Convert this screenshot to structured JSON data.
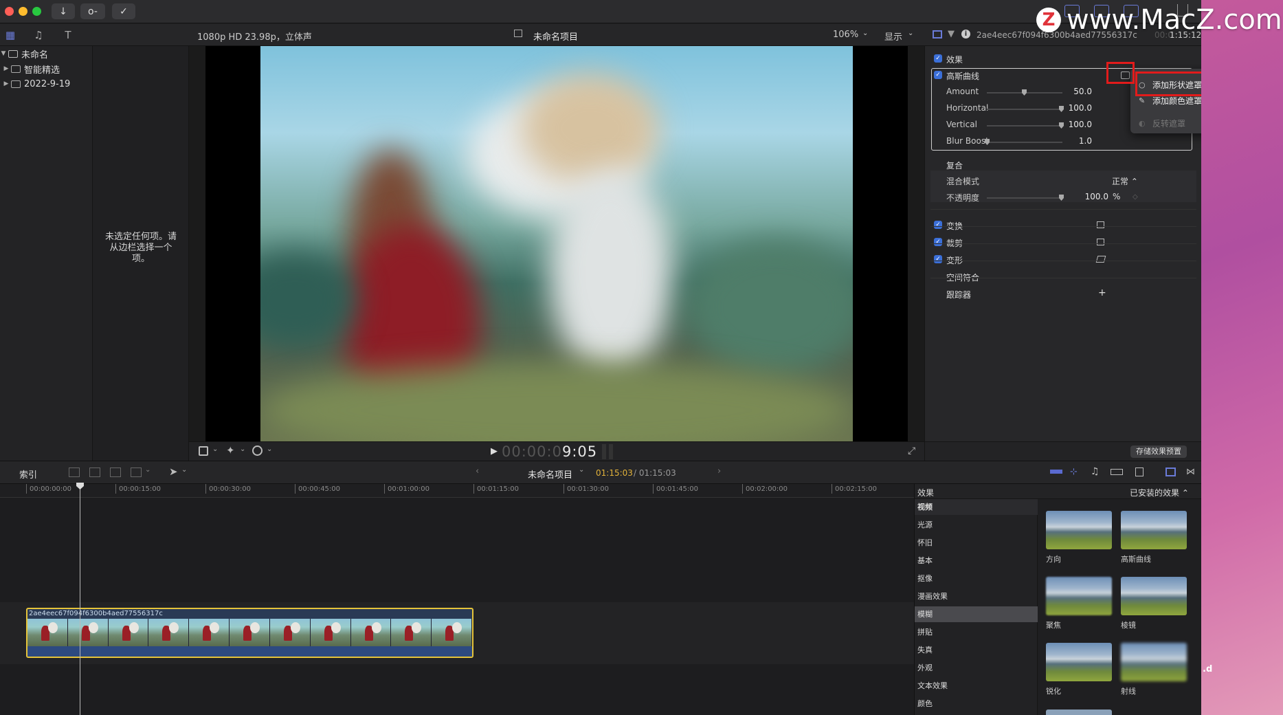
{
  "titlebar": {
    "lights": [
      "#ff5f57",
      "#febc2e",
      "#28c840"
    ],
    "buttons": [
      "↓",
      "o-",
      "✓"
    ]
  },
  "watermark": {
    "logo": "Z",
    "text": "www.MacZ.com"
  },
  "sidebar": {
    "items": [
      {
        "label": "未命名",
        "expanded": true
      },
      {
        "label": "智能精选"
      },
      {
        "label": "2022-9-19"
      }
    ]
  },
  "browser": {
    "empty_message": "未选定任何项。请从边栏选择一个项。"
  },
  "viewer": {
    "format": "1080p HD 23.98p，立体声",
    "project": "未命名项目",
    "zoom": "106%",
    "display_menu": "显示",
    "timecode_dim": "00:00:0",
    "timecode_bright": "9:05"
  },
  "inspector": {
    "clip_name": "2ae4eec67f094f6300b4aed77556317c",
    "duration": "1:15:12",
    "duration_prefix": "00:0",
    "effects_label": "效果",
    "effect_name": "高斯曲线",
    "params": [
      {
        "name": "Amount",
        "value": "50.0",
        "pos": 0.5
      },
      {
        "name": "Horizontal",
        "value": "100.0",
        "pos": 1.0
      },
      {
        "name": "Vertical",
        "value": "100.0",
        "pos": 1.0
      },
      {
        "name": "Blur Boost",
        "value": "1.0",
        "pos": 0.0
      }
    ],
    "composite_label": "复合",
    "blend_label": "混合模式",
    "blend_value": "正常 ⌃",
    "opacity_label": "不透明度",
    "opacity_value": "100.0",
    "opacity_unit": "%",
    "transform_label": "变换",
    "crop_label": "裁剪",
    "distort_label": "变形",
    "spatial_label": "空间符合",
    "tracker_label": "跟踪器",
    "tracker_add": "+",
    "save_preset": "存储效果预置"
  },
  "mask_menu": {
    "items": [
      {
        "label": "添加形状遮罩",
        "icon": "○",
        "enabled": true
      },
      {
        "label": "添加颜色遮罩",
        "icon": "✎",
        "enabled": true
      },
      {
        "label": "反转遮罩",
        "icon": "◐",
        "enabled": false
      }
    ]
  },
  "timeline": {
    "index_label": "索引",
    "project": "未命名项目",
    "position": "01:15:03",
    "total": "/ 01:15:03",
    "clip_name": "2ae4eec67f094f6300b4aed77556317c",
    "ticks": [
      "00:00:00:00",
      "00:00:15:00",
      "00:00:30:00",
      "00:00:45:00",
      "00:01:00:00",
      "00:01:15:00",
      "00:01:30:00",
      "00:01:45:00",
      "00:02:00:00",
      "00:02:15:00"
    ],
    "thumb_count": 11
  },
  "effects_browser": {
    "title": "效果",
    "installed": "已安装的效果 ⌃",
    "categories": [
      "视频",
      "光源",
      "怀旧",
      "基本",
      "抠像",
      "漫画效果",
      "模糊",
      "拼贴",
      "失真",
      "外观",
      "文本效果",
      "颜色"
    ],
    "selected_category": "模糊",
    "items": [
      "方向",
      "高斯曲线",
      "聚焦",
      "棱镜",
      "锐化",
      "射线"
    ]
  },
  "desktop": {
    "fragment": ".d"
  },
  "colors": {
    "accent": "#3b6fd8",
    "highlight_red": "#e21b1b",
    "clip_border": "#e6c43a",
    "timecode_accent": "#e2b23a"
  }
}
